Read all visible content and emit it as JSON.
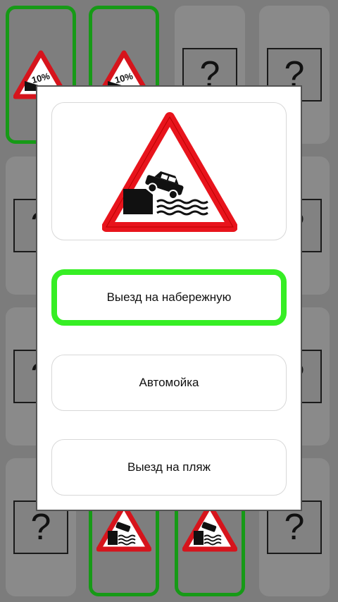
{
  "board": {
    "cards": [
      {
        "id": "r1c1",
        "state": "matched",
        "content": "steep-descent-sign",
        "sign_text": "10%"
      },
      {
        "id": "r1c2",
        "state": "matched",
        "content": "steep-descent-sign",
        "sign_text": "10%"
      },
      {
        "id": "r1c3",
        "state": "hidden",
        "content": "question",
        "text": "?"
      },
      {
        "id": "r1c4",
        "state": "hidden",
        "content": "question",
        "text": "?"
      },
      {
        "id": "r2c1",
        "state": "hidden",
        "content": "question",
        "text": "?"
      },
      {
        "id": "r2c4",
        "state": "hidden",
        "content": "question",
        "text": "?"
      },
      {
        "id": "r3c1",
        "state": "hidden",
        "content": "question",
        "text": "?"
      },
      {
        "id": "r3c4",
        "state": "hidden",
        "content": "question",
        "text": "?"
      },
      {
        "id": "r4c1",
        "state": "hidden",
        "content": "question",
        "text": "?"
      },
      {
        "id": "r4c2",
        "state": "matched",
        "content": "embankment-exit-sign"
      },
      {
        "id": "r4c3",
        "state": "matched",
        "content": "embankment-exit-sign"
      },
      {
        "id": "r4c4",
        "state": "hidden",
        "content": "question",
        "text": "?"
      }
    ],
    "colors": {
      "matched_border": "#169a16"
    }
  },
  "dialog": {
    "sign": "embankment-exit-sign",
    "answers": [
      {
        "label": "Выезд на набережную",
        "selected": true
      },
      {
        "label": "Автомойка",
        "selected": false
      },
      {
        "label": "Выезд на пляж",
        "selected": false
      }
    ],
    "colors": {
      "selected_border": "#36ee24",
      "sign_red": "#e8141c"
    }
  }
}
